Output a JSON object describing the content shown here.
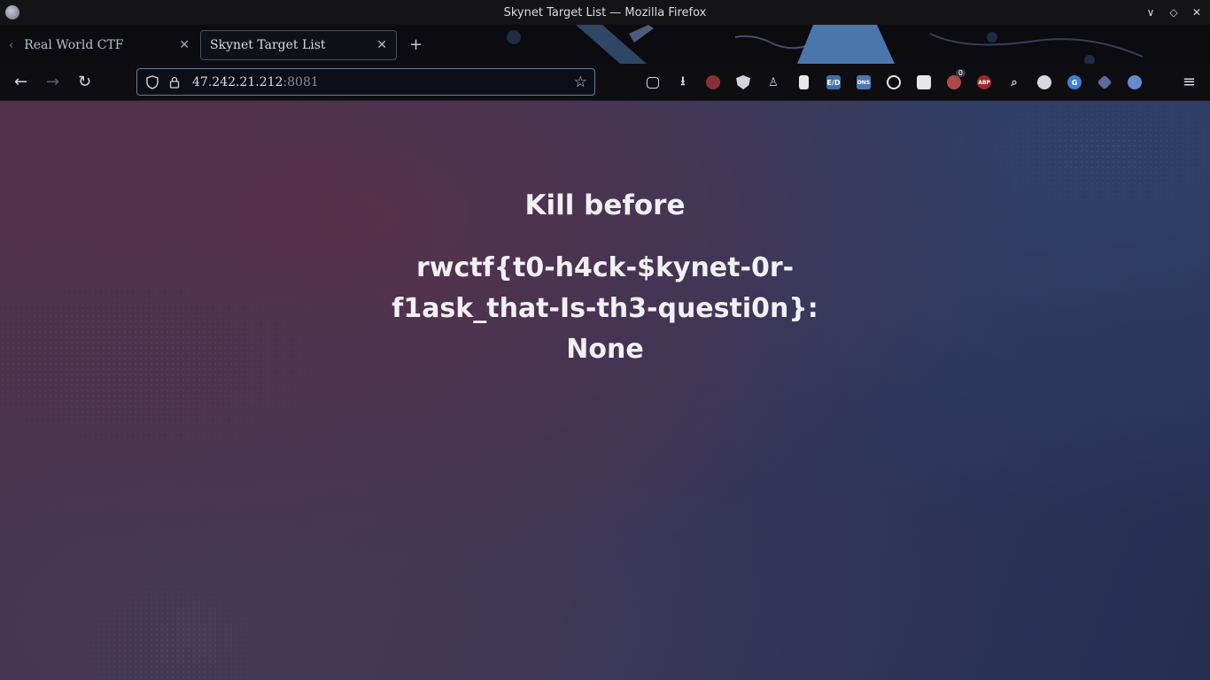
{
  "window": {
    "title": "Skynet Target List — Mozilla Firefox",
    "controls": [
      "∨",
      "◇",
      "✕"
    ]
  },
  "tabs": [
    {
      "label": "Real World CTF",
      "active": false
    },
    {
      "label": "Skynet Target List",
      "active": true
    }
  ],
  "navbar": {
    "url_host": "47.242.21.212",
    "url_port": ":8081",
    "extension_icons": [
      "pocket-icon",
      "downloads-icon",
      "ublock-icon",
      "privacy-badger-icon",
      "extension-icon",
      "reader-icon",
      "eo-icon",
      "dns-icon",
      "circle-icon",
      "save-icon",
      "firefox-extension-icon",
      "abp-icon",
      "search-icon",
      "network-icon",
      "google-icon",
      "shield-icon",
      "globe-icon"
    ],
    "badge_count": "0",
    "extension_labels": {
      "eo": "E/D",
      "dns": "DNS",
      "abp": "ABP"
    }
  },
  "content": {
    "heading": "Kill before",
    "flag_lines": [
      "rwctf{t0-h4ck-$kynet-0r-",
      "f1ask_that-Is-th3-questi0n}:",
      "None"
    ]
  },
  "colors": {
    "accent": "#5d7ea6",
    "titlebar_bg": "#141417",
    "content_text": "#f1f1f4"
  }
}
